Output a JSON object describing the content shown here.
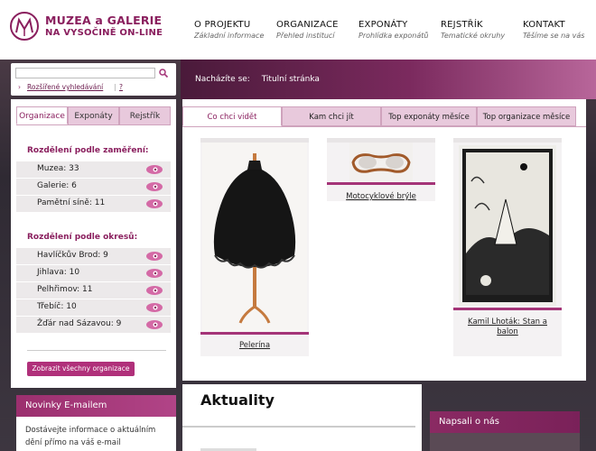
{
  "logo": {
    "line1": "MUZEA a GALERIE",
    "line2": "NA VYSOČINĚ ON-LINE"
  },
  "nav": [
    {
      "label": "O PROJEKTU",
      "sub": "Základní informace"
    },
    {
      "label": "ORGANIZACE",
      "sub": "Přehled institucí"
    },
    {
      "label": "EXPONÁTY",
      "sub": "Prohlídka exponátů"
    },
    {
      "label": "REJSTŘÍK",
      "sub": "Tematické okruhy"
    },
    {
      "label": "KONTAKT",
      "sub": "Těšíme se na vás"
    }
  ],
  "search": {
    "value": "",
    "advanced_label": "Rozšířené vyhledávání",
    "help_label": "?",
    "separator": "|"
  },
  "breadcrumb": {
    "prefix": "Nacházíte se:",
    "current": "Titulní stránka"
  },
  "left_tabs": [
    "Organizace",
    "Exponáty",
    "Rejstřík"
  ],
  "by_focus": {
    "title": "Rozdělení podle zaměření:",
    "items": [
      "Muzea: 33",
      "Galerie: 6",
      "Pamětní síně: 11"
    ]
  },
  "by_district": {
    "title": "Rozdělení podle okresů:",
    "items": [
      "Havlíčkův Brod: 9",
      "Jihlava: 10",
      "Pelhřimov: 11",
      "Třebíč: 10",
      "Žďár nad Sázavou: 9"
    ]
  },
  "show_all_label": "Zobrazit všechny organizace",
  "newsletter": {
    "title": "Novinky E-mailem",
    "text": "Dostávejte informace o aktuálním dění přímo na váš e-mail"
  },
  "main_tabs": [
    "Co chci vidět",
    "Kam chci jít",
    "Top exponáty měsíce",
    "Top organizace měsíce"
  ],
  "exhibits": [
    {
      "caption": "Pelerína"
    },
    {
      "caption": "Motocyklové brýle"
    },
    {
      "caption": "Kamil Lhoták: Stan a balon"
    }
  ],
  "aktuality_title": "Aktuality",
  "press_title": "Napsali o nás",
  "colors": {
    "brand": "#8a1f5e",
    "accent": "#b0307a",
    "tab_inactive": "#e8c9dc"
  }
}
